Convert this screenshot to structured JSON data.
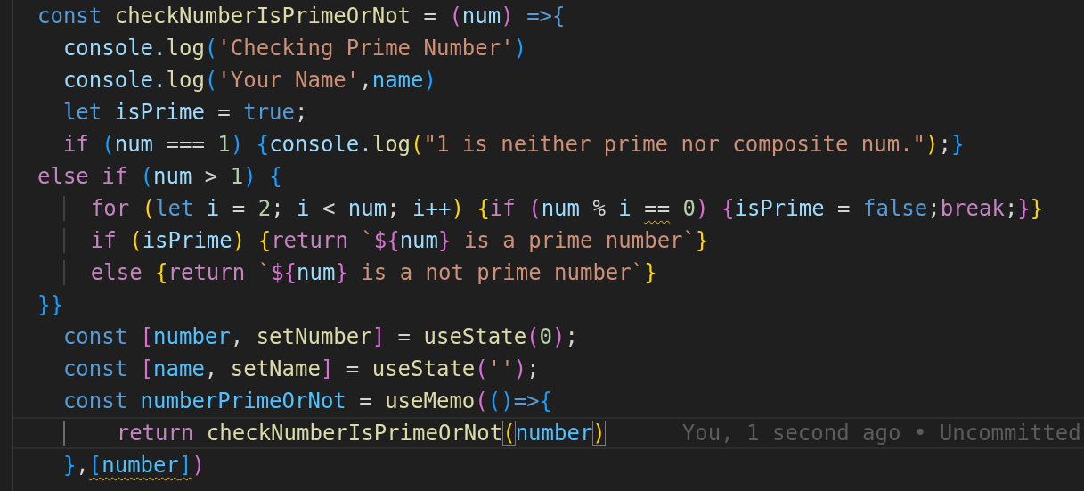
{
  "editor": {
    "lines": [
      {
        "tokens": [
          {
            "text": "const ",
            "kind": "kw"
          },
          {
            "text": "checkNumberIsPrimeOrNot",
            "kind": "fn"
          },
          {
            "text": " = ",
            "kind": "op"
          },
          {
            "text": "(",
            "kind": "b2"
          },
          {
            "text": "num",
            "kind": "var"
          },
          {
            "text": ") ",
            "kind": "b2"
          },
          {
            "text": "=>{",
            "kind": "kw"
          }
        ]
      },
      {
        "tokens": [
          {
            "text": "  console.",
            "kind": "var"
          },
          {
            "text": "log",
            "kind": "fn"
          },
          {
            "text": "(",
            "kind": "b3"
          },
          {
            "text": "'Checking Prime Number'",
            "kind": "str"
          },
          {
            "text": ")",
            "kind": "b3"
          }
        ]
      },
      {
        "tokens": [
          {
            "text": "  console.",
            "kind": "var"
          },
          {
            "text": "log",
            "kind": "fn"
          },
          {
            "text": "(",
            "kind": "b3"
          },
          {
            "text": "'Your Name'",
            "kind": "str"
          },
          {
            "text": ",",
            "kind": "op"
          },
          {
            "text": "name",
            "kind": "const"
          },
          {
            "text": ")",
            "kind": "b3"
          }
        ]
      },
      {
        "tokens": [
          {
            "text": "  let ",
            "kind": "kw"
          },
          {
            "text": "isPrime",
            "kind": "var"
          },
          {
            "text": " = ",
            "kind": "op"
          },
          {
            "text": "true",
            "kind": "kw"
          },
          {
            "text": ";",
            "kind": "op"
          }
        ]
      },
      {
        "tokens": [
          {
            "text": "  if ",
            "kind": "ctl"
          },
          {
            "text": "(",
            "kind": "b3"
          },
          {
            "text": "num",
            "kind": "var"
          },
          {
            "text": " === ",
            "kind": "op"
          },
          {
            "text": "1",
            "kind": "num"
          },
          {
            "text": ") ",
            "kind": "b3"
          },
          {
            "text": "{",
            "kind": "b3"
          },
          {
            "text": "console.",
            "kind": "var"
          },
          {
            "text": "log",
            "kind": "fn"
          },
          {
            "text": "(",
            "kind": "b1"
          },
          {
            "text": "\"1 is neither prime nor composite num.\"",
            "kind": "str"
          },
          {
            "text": ")",
            "kind": "b1"
          },
          {
            "text": ";",
            "kind": "op"
          },
          {
            "text": "}",
            "kind": "b3"
          }
        ]
      },
      {
        "tokens": [
          {
            "text": "else ",
            "kind": "ctl"
          },
          {
            "text": "if ",
            "kind": "ctl"
          },
          {
            "text": "(",
            "kind": "b3"
          },
          {
            "text": "num",
            "kind": "var"
          },
          {
            "text": " > ",
            "kind": "op"
          },
          {
            "text": "1",
            "kind": "num"
          },
          {
            "text": ") ",
            "kind": "b3"
          },
          {
            "text": "{",
            "kind": "b3"
          }
        ]
      },
      {
        "indent_guide": true,
        "tokens": [
          {
            "text": "    for ",
            "kind": "ctl"
          },
          {
            "text": "(",
            "kind": "b1"
          },
          {
            "text": "let ",
            "kind": "kw"
          },
          {
            "text": "i",
            "kind": "var"
          },
          {
            "text": " = ",
            "kind": "op"
          },
          {
            "text": "2",
            "kind": "num"
          },
          {
            "text": "; ",
            "kind": "op"
          },
          {
            "text": "i",
            "kind": "var"
          },
          {
            "text": " < ",
            "kind": "op"
          },
          {
            "text": "num",
            "kind": "var"
          },
          {
            "text": "; ",
            "kind": "op"
          },
          {
            "text": "i++",
            "kind": "var"
          },
          {
            "text": ") ",
            "kind": "b1"
          },
          {
            "text": "{",
            "kind": "b1"
          },
          {
            "text": "if ",
            "kind": "ctl"
          },
          {
            "text": "(",
            "kind": "b2"
          },
          {
            "text": "num",
            "kind": "var"
          },
          {
            "text": " % ",
            "kind": "op"
          },
          {
            "text": "i ",
            "kind": "var"
          },
          {
            "text": "==",
            "kind": "op",
            "squiggle": true
          },
          {
            "text": " 0",
            "kind": "num"
          },
          {
            "text": ") ",
            "kind": "b2"
          },
          {
            "text": "{",
            "kind": "b2"
          },
          {
            "text": "isPrime",
            "kind": "var"
          },
          {
            "text": " = ",
            "kind": "op"
          },
          {
            "text": "false",
            "kind": "kw"
          },
          {
            "text": ";",
            "kind": "op"
          },
          {
            "text": "break",
            "kind": "ctl"
          },
          {
            "text": ";",
            "kind": "op"
          },
          {
            "text": "}",
            "kind": "b2"
          },
          {
            "text": "}",
            "kind": "b1"
          }
        ]
      },
      {
        "indent_guide": true,
        "tokens": [
          {
            "text": "    if ",
            "kind": "ctl"
          },
          {
            "text": "(",
            "kind": "b1"
          },
          {
            "text": "isPrime",
            "kind": "var"
          },
          {
            "text": ") ",
            "kind": "b1"
          },
          {
            "text": "{",
            "kind": "b1"
          },
          {
            "text": "return ",
            "kind": "ctl"
          },
          {
            "text": "`",
            "kind": "str"
          },
          {
            "text": "${",
            "kind": "tpl"
          },
          {
            "text": "num",
            "kind": "var"
          },
          {
            "text": "}",
            "kind": "tpl"
          },
          {
            "text": " is a prime number`",
            "kind": "str"
          },
          {
            "text": "}",
            "kind": "b1"
          }
        ]
      },
      {
        "indent_guide": true,
        "tokens": [
          {
            "text": "    else ",
            "kind": "ctl"
          },
          {
            "text": "{",
            "kind": "b1"
          },
          {
            "text": "return ",
            "kind": "ctl"
          },
          {
            "text": "`",
            "kind": "str"
          },
          {
            "text": "${",
            "kind": "tpl"
          },
          {
            "text": "num",
            "kind": "var"
          },
          {
            "text": "}",
            "kind": "tpl"
          },
          {
            "text": " is a not prime number`",
            "kind": "str"
          },
          {
            "text": "}",
            "kind": "b1"
          }
        ]
      },
      {
        "tokens": [
          {
            "text": "}}",
            "kind": "b3"
          }
        ]
      },
      {
        "tokens": [
          {
            "text": "  const ",
            "kind": "kw"
          },
          {
            "text": "[",
            "kind": "b2"
          },
          {
            "text": "number",
            "kind": "const"
          },
          {
            "text": ", ",
            "kind": "op"
          },
          {
            "text": "setNumber",
            "kind": "fn"
          },
          {
            "text": "]",
            "kind": "b2"
          },
          {
            "text": " = ",
            "kind": "op"
          },
          {
            "text": "useState",
            "kind": "fn"
          },
          {
            "text": "(",
            "kind": "b2"
          },
          {
            "text": "0",
            "kind": "num"
          },
          {
            "text": ")",
            "kind": "b2"
          },
          {
            "text": ";",
            "kind": "op"
          }
        ]
      },
      {
        "tokens": [
          {
            "text": "  const ",
            "kind": "kw"
          },
          {
            "text": "[",
            "kind": "b2"
          },
          {
            "text": "name",
            "kind": "const"
          },
          {
            "text": ", ",
            "kind": "op"
          },
          {
            "text": "setName",
            "kind": "fn"
          },
          {
            "text": "]",
            "kind": "b2"
          },
          {
            "text": " = ",
            "kind": "op"
          },
          {
            "text": "useState",
            "kind": "fn"
          },
          {
            "text": "(",
            "kind": "b2"
          },
          {
            "text": "''",
            "kind": "str"
          },
          {
            "text": ")",
            "kind": "b2"
          },
          {
            "text": ";",
            "kind": "op"
          }
        ]
      },
      {
        "tokens": [
          {
            "text": "  const ",
            "kind": "kw"
          },
          {
            "text": "numberPrimeOrNot",
            "kind": "const"
          },
          {
            "text": " = ",
            "kind": "op"
          },
          {
            "text": "useMemo",
            "kind": "fn"
          },
          {
            "text": "(",
            "kind": "b2"
          },
          {
            "text": "()",
            "kind": "b3"
          },
          {
            "text": "=>",
            "kind": "kw"
          },
          {
            "text": "{",
            "kind": "b3"
          }
        ]
      },
      {
        "indent_guide": true,
        "current": true,
        "blame": "You, 1 second ago • Uncommitted",
        "tokens": [
          {
            "text": "      return ",
            "kind": "ctl"
          },
          {
            "text": "checkNumberIsPrimeOrNot",
            "kind": "fn"
          },
          {
            "text": "(",
            "kind": "b1",
            "bracket_match": true
          },
          {
            "text": "number",
            "kind": "const"
          },
          {
            "text": ")",
            "kind": "b1",
            "bracket_match": true
          }
        ]
      },
      {
        "tokens": [
          {
            "text": "  }",
            "kind": "b3"
          },
          {
            "text": ",",
            "kind": "op"
          },
          {
            "text": "[",
            "kind": "b3",
            "squiggle": true
          },
          {
            "text": "number",
            "kind": "const",
            "squiggle": true
          },
          {
            "text": "]",
            "kind": "b3",
            "squiggle": true
          },
          {
            "text": ")",
            "kind": "b2"
          }
        ]
      }
    ]
  }
}
